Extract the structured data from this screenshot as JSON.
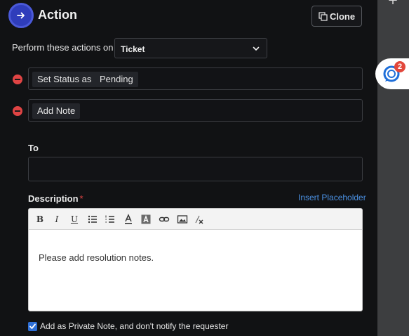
{
  "header": {
    "title": "Action",
    "clone_label": "Clone"
  },
  "perform": {
    "label": "Perform these actions on",
    "selected": "Ticket"
  },
  "actions": [
    {
      "type_chip": "Set Status as",
      "value_chip": "Pending"
    },
    {
      "type_chip": "Add Note"
    }
  ],
  "to": {
    "label": "To",
    "value": ""
  },
  "description": {
    "label": "Description",
    "required_marker": "*",
    "insert_link": "Insert Placeholder",
    "body_text": "Please add resolution notes.",
    "toolbar_icons": [
      "bold-icon",
      "italic-icon",
      "underline-icon",
      "bulleted-list-icon",
      "numbered-list-icon",
      "text-color-icon",
      "background-color-icon",
      "link-icon",
      "image-icon",
      "clear-format-icon"
    ]
  },
  "private_note": {
    "checked": true,
    "label": "Add as Private Note, and don't notify the requester"
  },
  "chat_widget": {
    "badge_count": "2"
  },
  "colors": {
    "accent": "#2e6fd6",
    "remove": "#e04444",
    "link": "#4a90e2",
    "brand_icon": "#2f3dbb"
  }
}
